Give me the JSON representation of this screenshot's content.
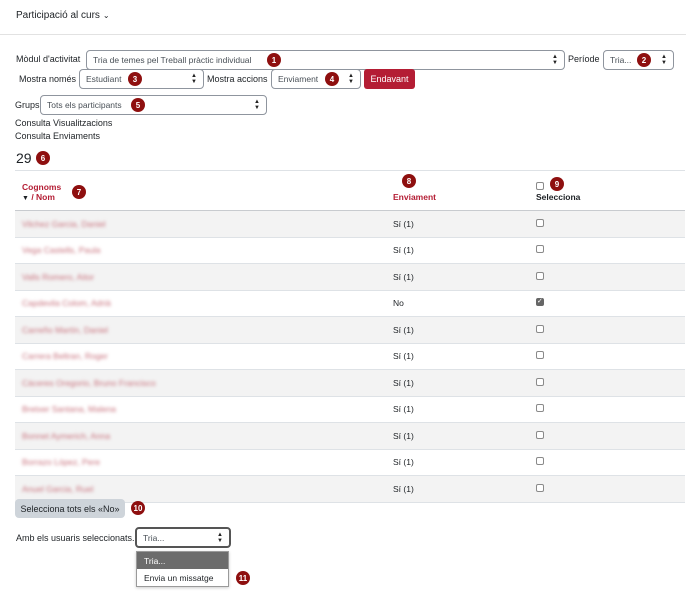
{
  "header": {
    "title": "Participació al curs"
  },
  "filters": {
    "module_label": "Mòdul d'activitat",
    "module_value": "Tria de temes pel Treball pràctic individual",
    "period_label": "Període",
    "period_value": "Tria...",
    "show_only_label": "Mostra només",
    "show_only_value": "Estudiant",
    "show_actions_label": "Mostra accions",
    "show_actions_value": "Enviament",
    "go_button": "Endavant",
    "groups_label": "Grups",
    "groups_value": "Tots els participants"
  },
  "links": {
    "views": "Consulta Visualitzacions",
    "submissions": "Consulta Enviaments"
  },
  "count": "29",
  "table": {
    "col_surname": "Cognoms",
    "col_name": "/ Nom",
    "col_submission": "Enviament",
    "col_select": "Selecciona",
    "rows": [
      {
        "name": "Vilchez Garcia, Daniel",
        "submission": "Sí (1)",
        "checked": false
      },
      {
        "name": "Vega Castells, Paula",
        "submission": "Sí (1)",
        "checked": false
      },
      {
        "name": "Valls Romero, Aitor",
        "submission": "Sí (1)",
        "checked": false
      },
      {
        "name": "Capdevila Colom, Adrià",
        "submission": "No",
        "checked": true
      },
      {
        "name": "Carreño Martín, Daniel",
        "submission": "Sí (1)",
        "checked": false
      },
      {
        "name": "Carrera Beltran, Roger",
        "submission": "Sí (1)",
        "checked": false
      },
      {
        "name": "Cáceres Oregorio, Bruno Francisco",
        "submission": "Sí (1)",
        "checked": false
      },
      {
        "name": "Bretxer Santana, Malena",
        "submission": "Sí (1)",
        "checked": false
      },
      {
        "name": "Bonnet Aymerich, Anna",
        "submission": "Sí (1)",
        "checked": false
      },
      {
        "name": "Borrazo López, Pere",
        "submission": "Sí (1)",
        "checked": false
      },
      {
        "name": "Anuel Garcia, Ruel",
        "submission": "Sí (1)",
        "checked": false
      }
    ]
  },
  "select_no_button": "Selecciona tots els «No»",
  "bulk": {
    "label": "Amb els usuaris seleccionats...",
    "value": "Tria...",
    "options": [
      "Tria...",
      "Envia un missatge"
    ]
  },
  "badges": [
    "1",
    "2",
    "3",
    "4",
    "5",
    "6",
    "7",
    "8",
    "9",
    "10",
    "11"
  ],
  "colors": {
    "accent": "#b41d34",
    "badge": "#8e0f0f"
  }
}
